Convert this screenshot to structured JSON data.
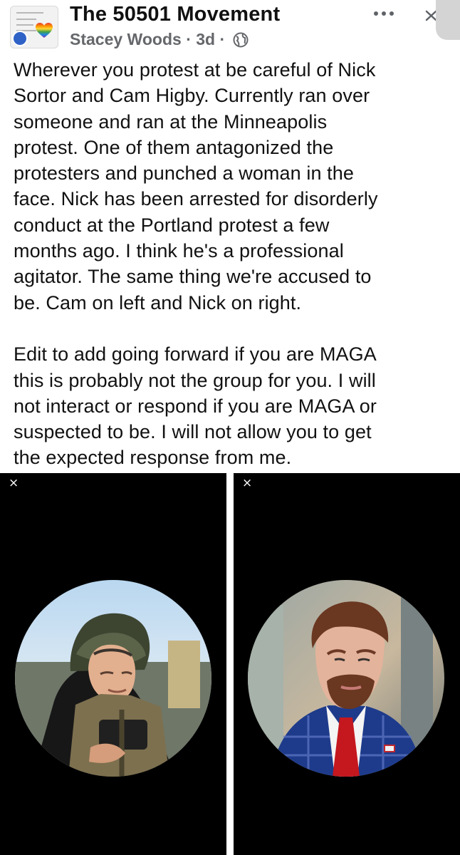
{
  "post": {
    "group_name": "The 50501 Movement",
    "author": "Stacey Woods",
    "separator": "·",
    "time_ago": "3d",
    "privacy_icon": "globe-icon",
    "body": "Wherever you protest at be careful of Nick\nSortor and Cam Higby. Currently ran over\nsomeone and ran at the Minneapolis\nprotest. One of them antagonized the\nprotesters and punched a woman in the\nface. Nick has been arrested for disorderly\nconduct at the Portland protest a few\nmonths ago. I think he's a professional\nagitator. The same thing we're accused to\nbe. Cam on left and Nick on right.\n\nEdit to add going forward if you are MAGA\nthis is probably not the group for you. I will\nnot interact or respond if you are MAGA or\nsuspected to be. I will not allow you to get\nthe expected response from me."
  },
  "photos": [
    {
      "close_label": "×",
      "subject": "helmeted-man-portrait"
    },
    {
      "close_label": "×",
      "subject": "suited-man-portrait"
    }
  ],
  "colors": {
    "text": "#111111",
    "meta": "#65676b",
    "photo_background": "#000000"
  }
}
